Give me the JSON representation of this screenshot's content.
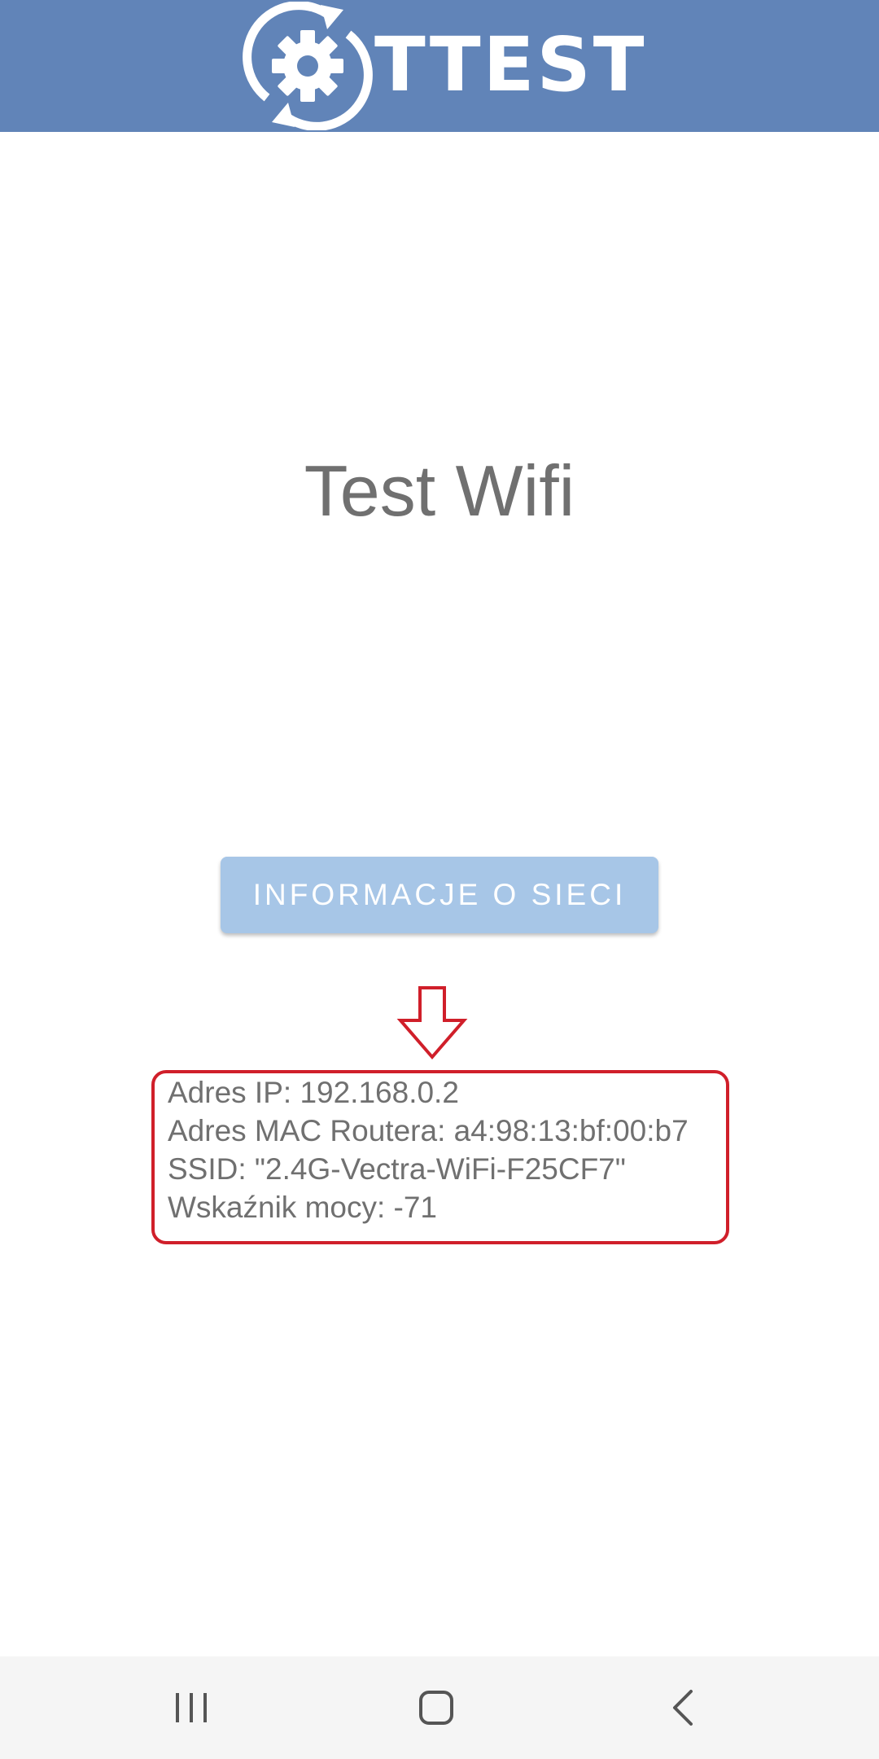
{
  "header": {
    "logo_text": "TTEST",
    "background_color": "#6184b8"
  },
  "main": {
    "title": "Test Wifi",
    "info_button_label": "INFORMACJE O SIECI",
    "info_button_color": "#a7c6e7"
  },
  "annotation": {
    "color": "#d01f2a",
    "arrow_icon": "arrow-down-outline-icon"
  },
  "network_info": {
    "lines": [
      "Adres IP: 192.168.0.2",
      "Adres MAC Routera: a4:98:13:bf:00:b7",
      "SSID: \"2.4G-Vectra-WiFi-F25CF7\"",
      "Wskaźnik mocy: -71"
    ]
  },
  "navbar": {
    "icons": [
      "recent-apps-icon",
      "home-icon",
      "back-icon"
    ]
  }
}
